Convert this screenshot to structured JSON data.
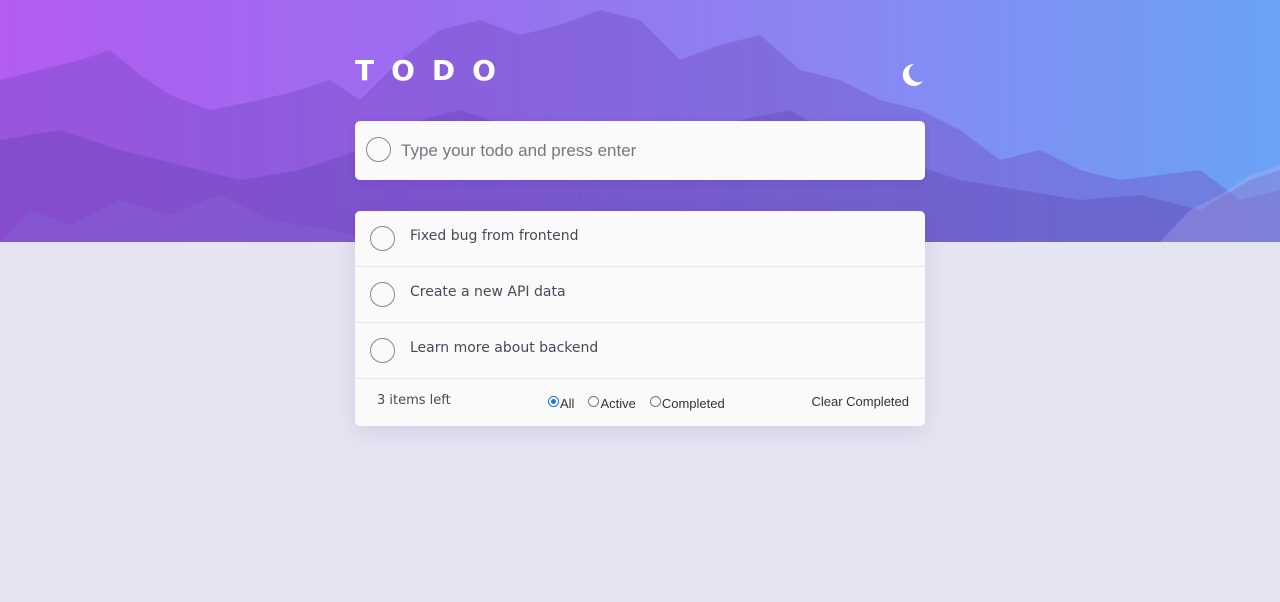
{
  "header": {
    "title": "TODO",
    "theme_icon": "moon-icon"
  },
  "new_todo": {
    "placeholder": "Type your todo and press enter",
    "value": ""
  },
  "todos": [
    {
      "text": "Fixed bug from frontend",
      "completed": false
    },
    {
      "text": "Create a new API data",
      "completed": false
    },
    {
      "text": "Learn more about backend",
      "completed": false
    }
  ],
  "footer": {
    "items_left": "3 items left",
    "filters": [
      {
        "label": "All",
        "selected": true
      },
      {
        "label": "Active",
        "selected": false
      },
      {
        "label": "Completed",
        "selected": false
      }
    ],
    "clear_label": "Clear Completed"
  },
  "colors": {
    "gradient_start": "#b25cf0",
    "gradient_end": "#6aa2f6",
    "page_background": "#e5e4f1",
    "card_background": "#fafafa"
  }
}
